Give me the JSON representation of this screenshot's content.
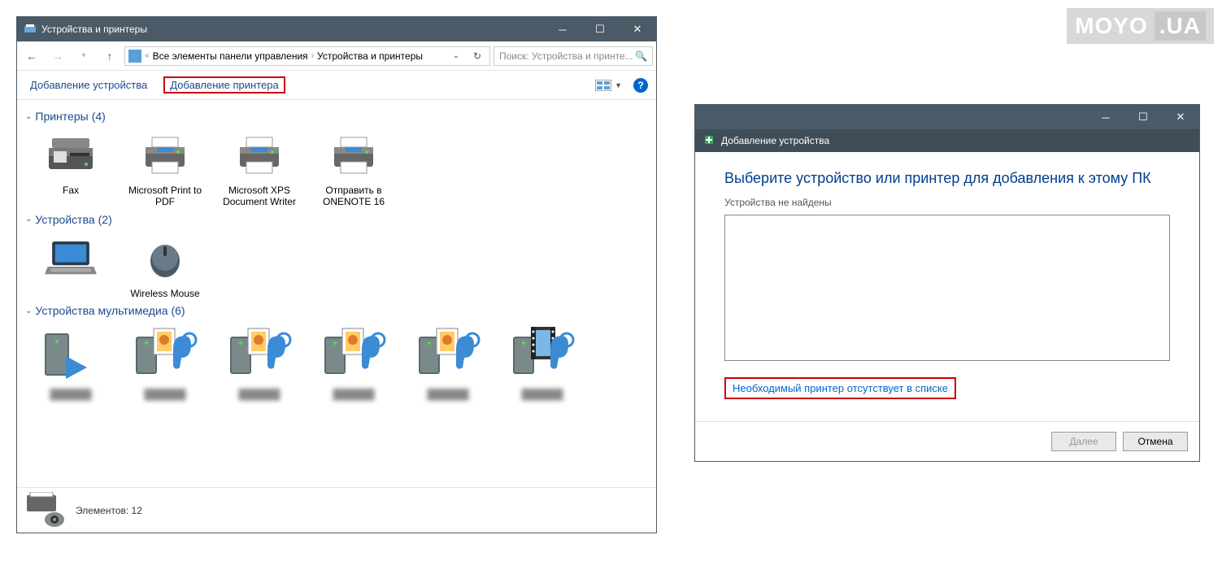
{
  "watermark": {
    "brand": "MOYO",
    "suffix": ".UA"
  },
  "mainWindow": {
    "title": "Устройства и принтеры",
    "nav": {
      "breadcrumb_prefix": "«",
      "crumb1": "Все элементы панели управления",
      "crumb2": "Устройства и принтеры",
      "search_placeholder": "Поиск: Устройства и принте..."
    },
    "toolbar": {
      "add_device": "Добавление устройства",
      "add_printer": "Добавление принтера"
    },
    "groups": {
      "printers": {
        "label": "Принтеры",
        "count": "(4)"
      },
      "devices": {
        "label": "Устройства",
        "count": "(2)"
      },
      "multimedia": {
        "label": "Устройства мультимедиа",
        "count": "(6)"
      }
    },
    "printers": [
      {
        "label": "Fax"
      },
      {
        "label": "Microsoft Print to PDF"
      },
      {
        "label": "Microsoft XPS Document Writer"
      },
      {
        "label": "Отправить в ONENOTE 16"
      }
    ],
    "devices": [
      {
        "label": ""
      },
      {
        "label": "Wireless Mouse"
      }
    ],
    "status": {
      "count_label": "Элементов: 12"
    }
  },
  "dialog": {
    "subtitle": "Добавление устройства",
    "heading": "Выберите устройство или принтер для добавления к этому ПК",
    "not_found": "Устройства не найдены",
    "missing_link": "Необходимый принтер отсутствует в списке",
    "next": "Далее",
    "cancel": "Отмена"
  }
}
